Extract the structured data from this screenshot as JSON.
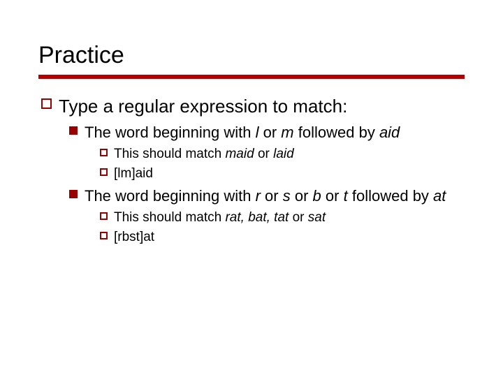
{
  "title": "Practice",
  "accent_color": "#b40000",
  "items": [
    {
      "text": "Type a regular expression to match:",
      "children": [
        {
          "pre": "The word beginning with ",
          "it1": "l",
          "mid1": " or ",
          "it2": "m",
          "mid2": " followed by ",
          "it3": "aid",
          "children": [
            {
              "pre": "This should match ",
              "it1": "maid",
              "mid": " or ",
              "it2": "laid"
            },
            {
              "text": "[lm]aid"
            }
          ]
        },
        {
          "pre": "The word beginning with ",
          "it1": "r",
          "mid1": " or ",
          "it2": "s",
          "mid2": " or ",
          "it3": "b",
          "mid3": " or ",
          "it4": "t",
          "mid4": " followed by ",
          "it5": "at",
          "children": [
            {
              "pre": "This should match ",
              "it1": "rat, bat, tat",
              "mid": " or ",
              "it2": "sat"
            },
            {
              "text": "[rbst]at"
            }
          ]
        }
      ]
    }
  ]
}
